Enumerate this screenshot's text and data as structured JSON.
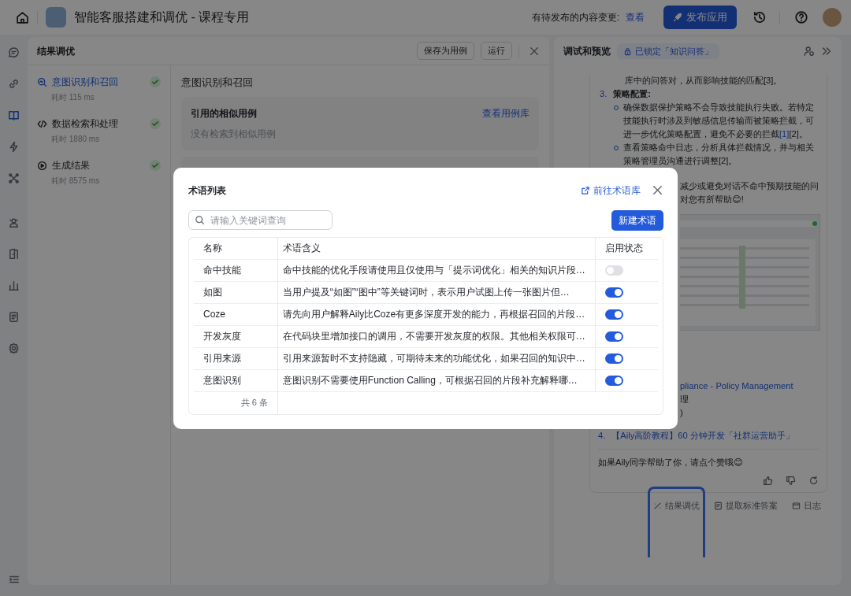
{
  "topbar": {
    "title": "智能客服搭建和调优 - 课程专用",
    "pending_label": "有待发布的内容变更:",
    "pending_link": "查看",
    "publish_button": "发布应用"
  },
  "rail": {
    "items": [
      {
        "selected": false
      },
      {
        "selected": false
      },
      {
        "selected": true
      },
      {
        "selected": false
      },
      {
        "selected": false
      },
      {
        "selected": false
      },
      {
        "selected": false
      },
      {
        "selected": false
      },
      {
        "selected": false
      },
      {
        "selected": false
      }
    ]
  },
  "tuning_panel": {
    "title": "结果调优",
    "buttons": [
      "保存为用例",
      "运行"
    ],
    "steps": [
      {
        "name": "意图识别和召回",
        "time": "耗时 115 ms",
        "selected": true,
        "done": true
      },
      {
        "name": "数据检索和处理",
        "time": "耗时 1880 ms",
        "selected": false,
        "done": true
      },
      {
        "name": "生成结果",
        "time": "耗时 8575 ms",
        "selected": false,
        "done": true
      }
    ],
    "section_title": "意图识别和召回",
    "similar_cases": {
      "title": "引用的相似用例",
      "link": "查看用例库",
      "empty": "没有检索到相似用例"
    }
  },
  "preview_panel": {
    "title": "调试和预览",
    "lock_badge": "已锁定「知识问答」",
    "blocks": [
      {
        "kind": "text",
        "segments": [
          {
            "text": "库中的问答对，从而影响技能的匹配[3]。",
            "link": false
          }
        ]
      },
      {
        "kind": "heading",
        "number": "3.",
        "segments": [
          {
            "text": "策略配置:",
            "link": false
          }
        ]
      },
      {
        "kind": "bullet",
        "segments": [
          {
            "text": "确保数据保护策略不会导致技能执行失败。若特定技能执行时涉及到敏感信息传输而被策略拦截，可进一步优化策略配置，避免不必要的拦截",
            "link": false
          },
          {
            "text": "[1]",
            "link": true
          },
          {
            "text": "[2]。",
            "link": false
          }
        ]
      },
      {
        "kind": "bullet",
        "segments": [
          {
            "text": "查看策略命中日志，分析具体拦截情况，并与相关策略管理员沟通进行调整[2]。",
            "link": false
          }
        ]
      }
    ],
    "partial_lines_top": [
      "减少或避免对话不命中预期技能的问",
      "对您有所帮助😊!"
    ],
    "partial_lines_bottom": [
      {
        "text": "pliance - Policy Management",
        "link": true
      },
      {
        "text": "理",
        "link": false
      },
      {
        "text": ")",
        "link": false
      }
    ],
    "reference": {
      "number": "4.",
      "text": "【Aily高阶教程】60 分钟开发「社群运营助手」"
    },
    "closing": "如果Aily同学帮助了你，请点个赞哦😊",
    "actions": [
      "结果调优",
      "提取标准答案",
      "日志"
    ]
  },
  "term_modal": {
    "title": "术语列表",
    "link": "前往术语库",
    "search": {
      "placeholder": "请输入关键词查询"
    },
    "new_button": "新建术语",
    "columns": [
      "名称",
      "术语含义",
      "启用状态"
    ],
    "rows": [
      {
        "name": "命中技能",
        "meaning": "命中技能的优化手段请使用且仅使用与「提示词优化」相关的知识片段…",
        "enabled": false
      },
      {
        "name": "如图",
        "meaning": "当用户提及“如图”“图中”等关键词时，表示用户试图上传一张图片但…",
        "enabled": true
      },
      {
        "name": "Coze",
        "meaning": "请先向用户解释Aily比Coze有更多深度开发的能力，再根据召回的片段…",
        "enabled": true
      },
      {
        "name": "开发灰度",
        "meaning": "在代码块里增加接口的调用，不需要开发灰度的权限。其他相关权限可…",
        "enabled": true
      },
      {
        "name": "引用来源",
        "meaning": "引用来源暂时不支持隐藏，可期待未来的功能优化，如果召回的知识中…",
        "enabled": true
      },
      {
        "name": "意图识别",
        "meaning": "意图识别不需要使用Function Calling，可根据召回的片段补充解释哪…",
        "enabled": true
      }
    ],
    "total": "共 6 条"
  }
}
